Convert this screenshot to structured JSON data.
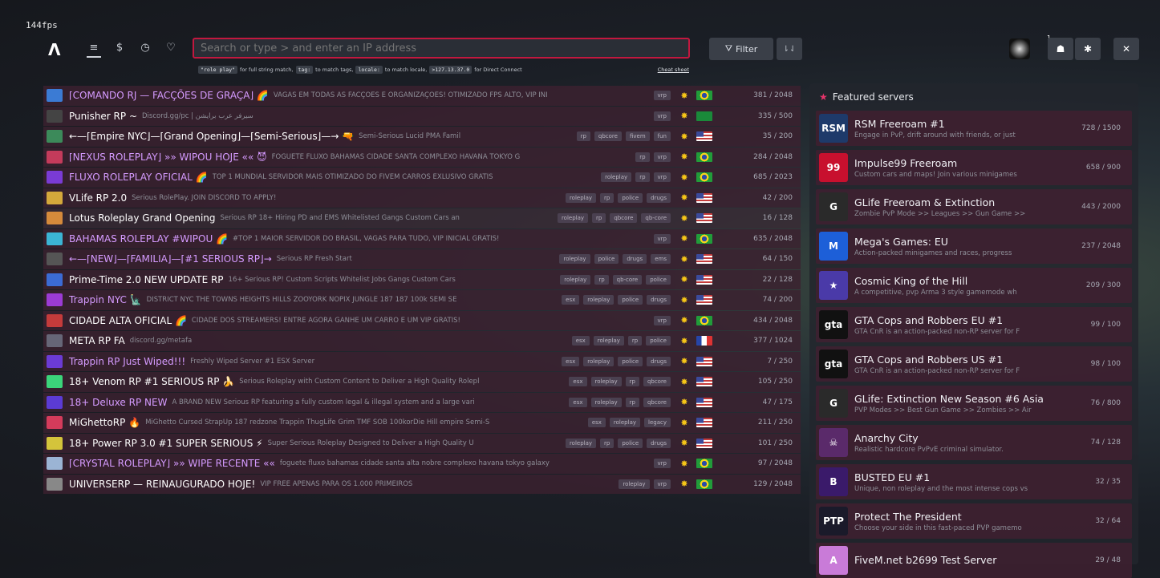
{
  "header": {
    "fps": "144fps",
    "logo": "Λ",
    "nav": [
      "≡",
      "$",
      "◷",
      "♡"
    ],
    "search_placeholder": "Search or type > and enter an IP address",
    "filter_label": "Filter",
    "sort_label": "⇂⇃",
    "badge": "1",
    "notify_icon": "☗",
    "settings_icon": "✱",
    "close_icon": "✕"
  },
  "hints": {
    "code1": "\"role play\"",
    "text1": "for full string match,",
    "code2": "tag:",
    "text2": "to match tags,",
    "code3": "locale:",
    "text3": "to match locale,",
    "code4": ">127.13.37.0",
    "text4": "for Direct Connect",
    "cheat": "Cheat sheet"
  },
  "servers": [
    {
      "name": "⌈COMANDO RJ — FACÇÕES DE GRAÇA⌋ 🌈",
      "color": "#d59bff",
      "desc": "VAGAS EM TODAS AS FACÇÕES E ORGANIZAÇÕES! OTIMIZADO FPS ALTO, VIP INI",
      "tags": [
        "vrp"
      ],
      "flag": "br",
      "count": "381 / 2048",
      "icon": "#3b7bd4"
    },
    {
      "name": "Punisher RP ~",
      "color": "#ffffff",
      "desc": "Discord.gg/pc | سيرفر عرب برايشن",
      "tags": [
        "vrp"
      ],
      "flag": "sa",
      "count": "335 / 500",
      "icon": "#444"
    },
    {
      "name": "←—⌈Empire NYC⌋—⌈Grand Opening⌋—⌈Semi-Serious⌋—→ 🔫",
      "color": "#ffffff",
      "desc": "Semi-Serious Lucid PMA Famil",
      "tags": [
        "rp",
        "qbcore",
        "fivem",
        "fun"
      ],
      "flag": "us",
      "count": "35 / 200",
      "icon": "#3c8a5a"
    },
    {
      "name": "⌈NEXUS ROLEPLAY⌋ »» WIPOU HOJE «« 😈",
      "color": "#d59bff",
      "desc": "FOGUETE FLUXO BAHAMAS CIDADE SANTA COMPLEXO HAVANA TOKYO G",
      "tags": [
        "rp",
        "vrp"
      ],
      "flag": "br",
      "count": "284 / 2048",
      "icon": "#c43b5b"
    },
    {
      "name": "FLUXO ROLEPLAY OFICIAL 🌈",
      "color": "#d59bff",
      "desc": "TOP 1 MUNDIAL SERVIDOR MAIS OTIMIZADO DO FIVEM CARROS EXLUSIVO GRATIS",
      "tags": [
        "roleplay",
        "rp",
        "vrp"
      ],
      "flag": "br",
      "count": "685 / 2023",
      "icon": "#7a3bd4"
    },
    {
      "name": "VLife RP 2.0",
      "color": "#ffffff",
      "desc": "Serious RolePlay. JOIN DISCORD TO APPLY!",
      "tags": [
        "roleplay",
        "rp",
        "police",
        "drugs"
      ],
      "flag": "us",
      "count": "42 / 200",
      "icon": "#d4a83b"
    },
    {
      "name": "Lotus Roleplay Grand Opening",
      "color": "#ffffff",
      "desc": "Serious RP 18+ Hiring PD and EMS Whitelisted Gangs Custom Cars an",
      "tags": [
        "roleplay",
        "rp",
        "qbcore",
        "qb-core"
      ],
      "flag": "us",
      "count": "16 / 128",
      "icon": "#d48a3b",
      "alt": true
    },
    {
      "name": "BAHAMAS ROLEPLAY #WIPOU 🌈",
      "color": "#d59bff",
      "desc": "#TOP 1 MAIOR SERVIDOR DO BRASIL, VAGAS PARA TUDO, VIP INICIAL GRATIS!",
      "tags": [
        "vrp"
      ],
      "flag": "br",
      "count": "635 / 2048",
      "icon": "#3bb4d4"
    },
    {
      "name": "←—⌈NEW⌋—⌈FAMILIA⌋—⌈#1 SERIOUS RP⌋→",
      "color": "#d59bff",
      "desc": "Serious RP Fresh Start",
      "tags": [
        "roleplay",
        "police",
        "drugs",
        "ems"
      ],
      "flag": "us",
      "count": "64 / 150",
      "icon": "#555"
    },
    {
      "name": "Prime-Time 2.0 NEW UPDATE RP",
      "color": "#ffffff",
      "desc": "16+ Serious RP! Custom Scripts Whitelist Jobs Gangs Custom Cars",
      "tags": [
        "roleplay",
        "rp",
        "qb-core",
        "police"
      ],
      "flag": "us",
      "count": "22 / 128",
      "icon": "#3b6bd4"
    },
    {
      "name": "Trappin NYC 🗽",
      "color": "#d59bff",
      "desc": "DISTRICT NYC THE TOWNS HEIGHTS HILLS ZOOYORK NOPIX JUNGLE 187 187 100k SEMI SE",
      "tags": [
        "esx",
        "roleplay",
        "police",
        "drugs"
      ],
      "flag": "us",
      "count": "74 / 200",
      "icon": "#9b3bd4"
    },
    {
      "name": "CIDADE ALTA OFICIAL 🌈",
      "color": "#ffffff",
      "desc": "CIDADE DOS STREAMERS! ENTRE AGORA GANHE UM CARRO E UM VIP GRÁTIS!",
      "tags": [
        "vrp"
      ],
      "flag": "br",
      "count": "434 / 2048",
      "icon": "#c43b3b"
    },
    {
      "name": "META RP FA",
      "color": "#ffffff",
      "desc": "discord.gg/metafa",
      "tags": [
        "esx",
        "roleplay",
        "rp",
        "police"
      ],
      "flag": "fr",
      "count": "377 / 1024",
      "icon": "#667"
    },
    {
      "name": "Trappin RP Just Wiped!!!",
      "color": "#d59bff",
      "desc": "Freshly Wiped Server #1 ESX Server",
      "tags": [
        "esx",
        "roleplay",
        "police",
        "drugs"
      ],
      "flag": "us",
      "count": "7 / 250",
      "icon": "#6b3bd4"
    },
    {
      "name": "18+ Venom RP #1 SERIOUS RP 🍌",
      "color": "#ffffff",
      "desc": "Serious Roleplay with Custom Content to Deliver a High Quality Rolepl",
      "tags": [
        "esx",
        "roleplay",
        "rp",
        "qbcore"
      ],
      "flag": "us",
      "count": "105 / 250",
      "icon": "#3bd47a"
    },
    {
      "name": "18+ Deluxe RP NEW",
      "color": "#d59bff",
      "desc": "A BRAND NEW Serious RP featuring a fully custom legal & illegal system and a large vari",
      "tags": [
        "esx",
        "roleplay",
        "rp",
        "qbcore"
      ],
      "flag": "us",
      "count": "47 / 175",
      "icon": "#5b3bd4"
    },
    {
      "name": "MiGhettoRP 🔥",
      "color": "#ffffff",
      "desc": "MiGhetto Cursed StrapUp 187 redzone Trappin ThugLife Grim TMF SOB 100korDie Hill empire Semi-S",
      "tags": [
        "esx",
        "roleplay",
        "legacy"
      ],
      "flag": "us",
      "count": "211 / 250",
      "icon": "#d43b5b"
    },
    {
      "name": "18+ Power RP 3.0 #1 SUPER SERIOUS ⚡",
      "color": "#ffffff",
      "desc": "Super Serious Roleplay Designed to Deliver a High Quality U",
      "tags": [
        "roleplay",
        "rp",
        "police",
        "drugs"
      ],
      "flag": "us",
      "count": "101 / 250",
      "icon": "#d4c43b"
    },
    {
      "name": "⌈CRYSTAL ROLEPLAY⌋ »» WIPE RECENTE ««",
      "color": "#d59bff",
      "desc": "foguete fluxo bahamas cidade santa alta nobre complexo havana tokyo galaxy",
      "tags": [
        "vrp"
      ],
      "flag": "br",
      "count": "97 / 2048",
      "icon": "#9bb4d4"
    },
    {
      "name": "UNIVERSERP — REINAUGURADO HOJE!",
      "color": "#ffffff",
      "desc": "VIP FREE APENAS PARA OS 1.000 PRIMEIROS",
      "tags": [
        "roleplay",
        "vrp"
      ],
      "flag": "br",
      "count": "129 / 2048",
      "icon": "#888"
    }
  ],
  "featured": {
    "title": "Featured servers",
    "items": [
      {
        "name": "RSM Freeroam #1",
        "desc": "Engage in PvP, drift around with friends, or just",
        "count": "728 / 1500",
        "icon": "RSM",
        "bg": "#1e3a6a"
      },
      {
        "name": "Impulse99 Freeroam",
        "desc": "Custom cars and maps! Join various minigames",
        "count": "658 / 900",
        "icon": "99",
        "bg": "#c8102e"
      },
      {
        "name": "GLife Freeroam & Extinction",
        "desc": "Zombie PvP Mode >> Leagues >> Gun Game >>",
        "count": "443 / 2000",
        "icon": "G",
        "bg": "#2a2a2a"
      },
      {
        "name": "Mega's Games: EU",
        "desc": "Action-packed minigames and races, progress",
        "count": "237 / 2048",
        "icon": "M",
        "bg": "#1d5fd8"
      },
      {
        "name": "Cosmic King of the Hill",
        "desc": "A competitive, pvp Arma 3 style gamemode wh",
        "count": "209 / 300",
        "icon": "★",
        "bg": "#4a3aa8"
      },
      {
        "name": "GTA Cops and Robbers EU #1",
        "desc": "GTA CnR is an action-packed non-RP server for F",
        "count": "99 / 100",
        "icon": "gta",
        "bg": "#111"
      },
      {
        "name": "GTA Cops and Robbers US #1",
        "desc": "GTA CnR is an action-packed non-RP server for F",
        "count": "98 / 100",
        "icon": "gta",
        "bg": "#111"
      },
      {
        "name": "GLife: Extinction New Season #6 Asia",
        "desc": "PVP Modes >> Best Gun Game >> Zombies >> Air",
        "count": "76 / 800",
        "icon": "G",
        "bg": "#2a2a2a"
      },
      {
        "name": "Anarchy City",
        "desc": "Realistic hardcore PvPvE criminal simulator.",
        "count": "74 / 128",
        "icon": "☠",
        "bg": "#5a2a6a"
      },
      {
        "name": "BUSTED EU #1",
        "desc": "Unique, non roleplay and the most intense cops vs",
        "count": "32 / 35",
        "icon": "B",
        "bg": "#3a1a6a"
      },
      {
        "name": "Protect The President",
        "desc": "Choose your side in this fast-paced PVP gamemo",
        "count": "32 / 64",
        "icon": "PTP",
        "bg": "#1a1a2a"
      },
      {
        "name": "FiveM.net b2699 Test Server",
        "desc": "",
        "count": "29 / 48",
        "icon": "A",
        "bg": "#c97bd8"
      }
    ]
  }
}
